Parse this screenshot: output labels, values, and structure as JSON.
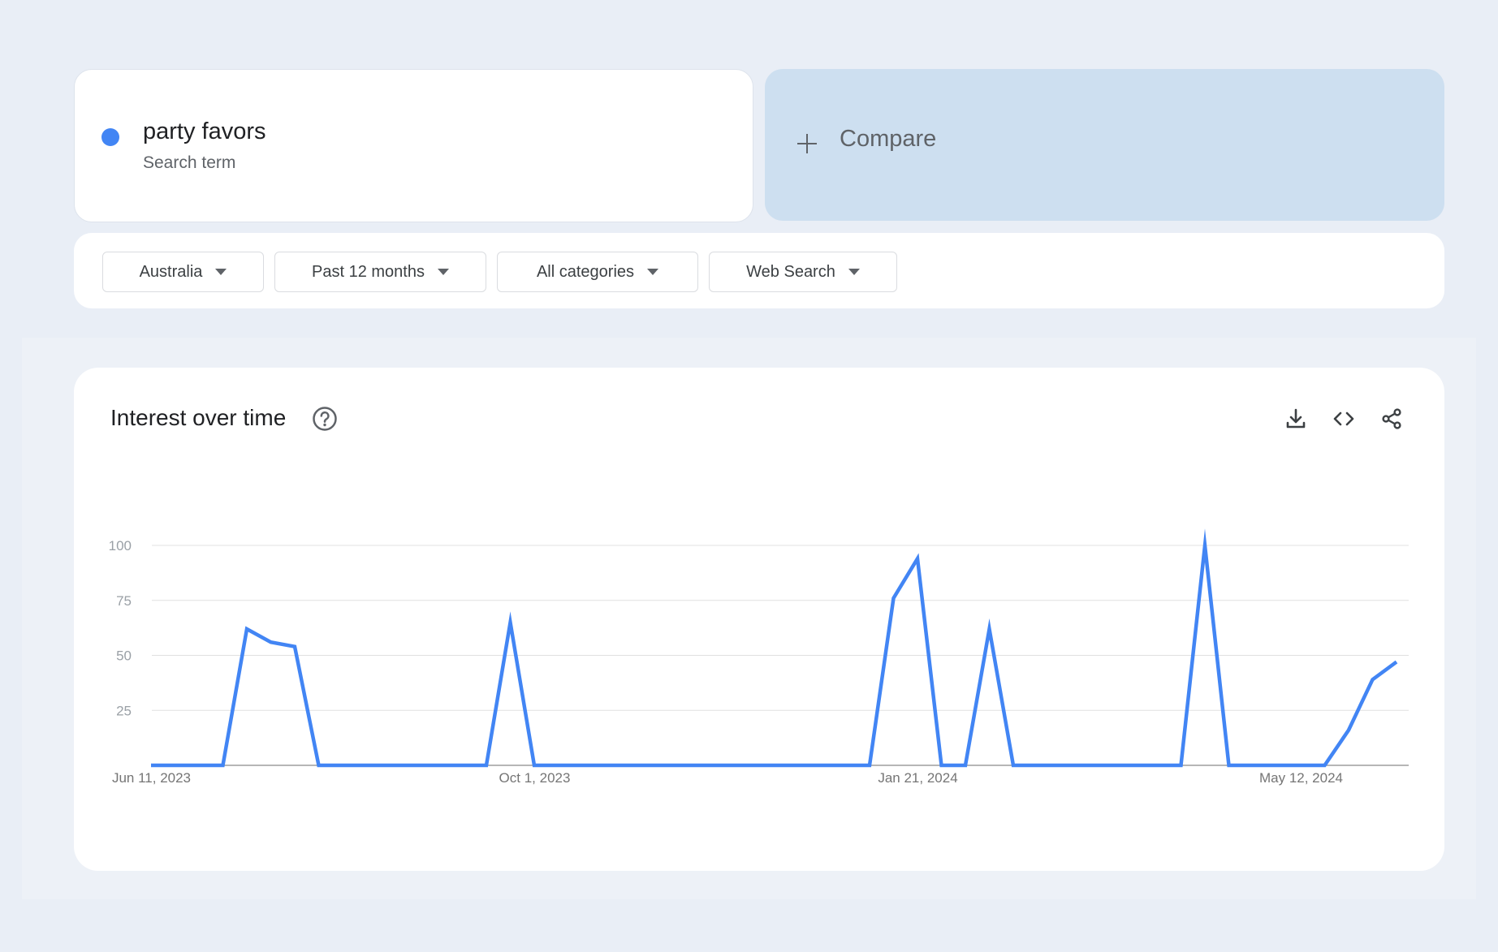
{
  "term": {
    "name": "party favors",
    "type": "Search term",
    "color": "#4285f4"
  },
  "compare": {
    "label": "Compare"
  },
  "filters": [
    "Australia",
    "Past 12 months",
    "All categories",
    "Web Search"
  ],
  "card": {
    "title": "Interest over time"
  },
  "icons": {
    "help": "help-circle-icon",
    "download": "download-icon",
    "embed": "code-icon",
    "share": "share-icon"
  },
  "chart_data": {
    "type": "line",
    "title": "Interest over time",
    "xlabel": "",
    "ylabel": "",
    "ylim": [
      0,
      100
    ],
    "yticks": [
      25,
      50,
      75,
      100
    ],
    "grid": true,
    "legend": "none",
    "x_tick_labels": [
      "Jun 11, 2023",
      "Oct 1, 2023",
      "Jan 21, 2024",
      "May 12, 2024"
    ],
    "x_tick_indices": [
      0,
      16,
      32,
      48
    ],
    "series": [
      {
        "color": "#4285f4",
        "values": [
          0,
          0,
          0,
          0,
          62,
          56,
          54,
          0,
          0,
          0,
          0,
          0,
          0,
          0,
          0,
          65,
          0,
          0,
          0,
          0,
          0,
          0,
          0,
          0,
          0,
          0,
          0,
          0,
          0,
          0,
          0,
          76,
          94,
          0,
          0,
          62,
          0,
          0,
          0,
          0,
          0,
          0,
          0,
          0,
          100,
          0,
          0,
          0,
          0,
          0,
          16,
          39,
          47
        ]
      }
    ]
  }
}
